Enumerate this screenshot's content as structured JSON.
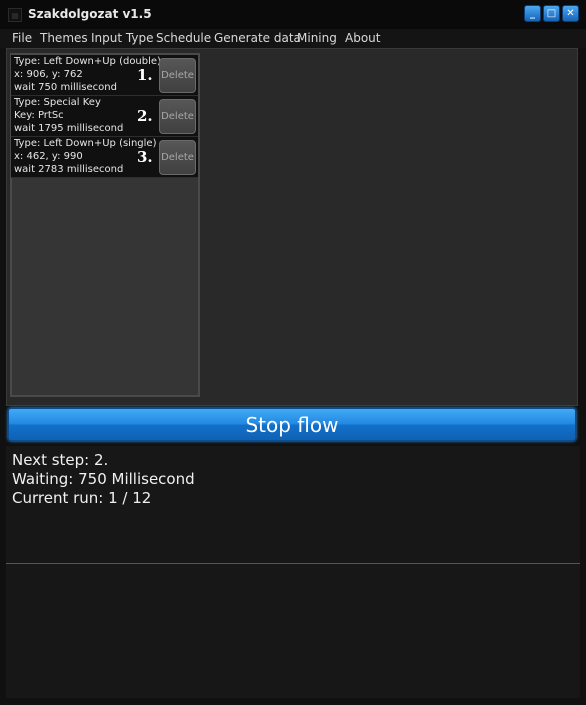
{
  "window": {
    "title": "Szakdolgozat v1.5"
  },
  "menu": [
    "File",
    "Themes",
    "Input Type",
    "Schedule",
    "Generate data",
    "Mining",
    "About"
  ],
  "steps": [
    {
      "line1": "Type: Left Down+Up (double)",
      "line2": "x: 906, y: 762",
      "line3": "wait 750 millisecond",
      "number": "1.",
      "delete": "Delete"
    },
    {
      "line1": "Type: Special Key",
      "line2": "Key: PrtSc",
      "line3": "wait 1795 millisecond",
      "number": "2.",
      "delete": "Delete"
    },
    {
      "line1": "Type: Left Down+Up (single)",
      "line2": "x: 462, y: 990",
      "line3": "wait 2783 millisecond",
      "number": "3.",
      "delete": "Delete"
    }
  ],
  "action_button": "Stop flow",
  "status": {
    "next_step": "Next step: 2.",
    "waiting": "Waiting: 750 Millisecond",
    "current_run": "Current run: 1 / 12"
  },
  "colors": {
    "accent": "#1a7fd8",
    "background": "#101010",
    "panel": "#292929"
  }
}
